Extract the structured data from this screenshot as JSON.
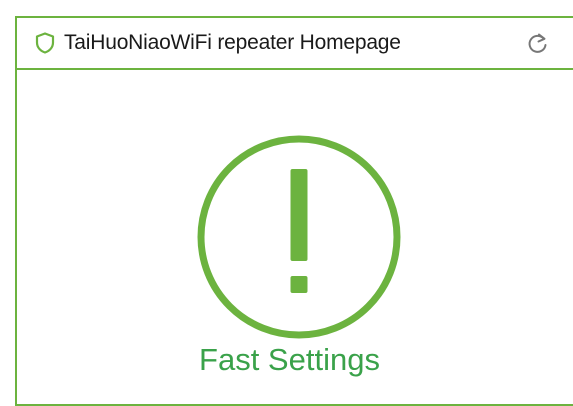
{
  "address_bar": {
    "title": "TaiHuoNiaoWiFi repeater Homepage",
    "security_icon": "shield-icon",
    "reload_icon": "reload-icon"
  },
  "main": {
    "status_icon": "alert-icon",
    "label": "Fast Settings"
  },
  "colors": {
    "accent": "#6cb33f",
    "label_text": "#3aa24a",
    "title_text": "#1a1a1a"
  }
}
